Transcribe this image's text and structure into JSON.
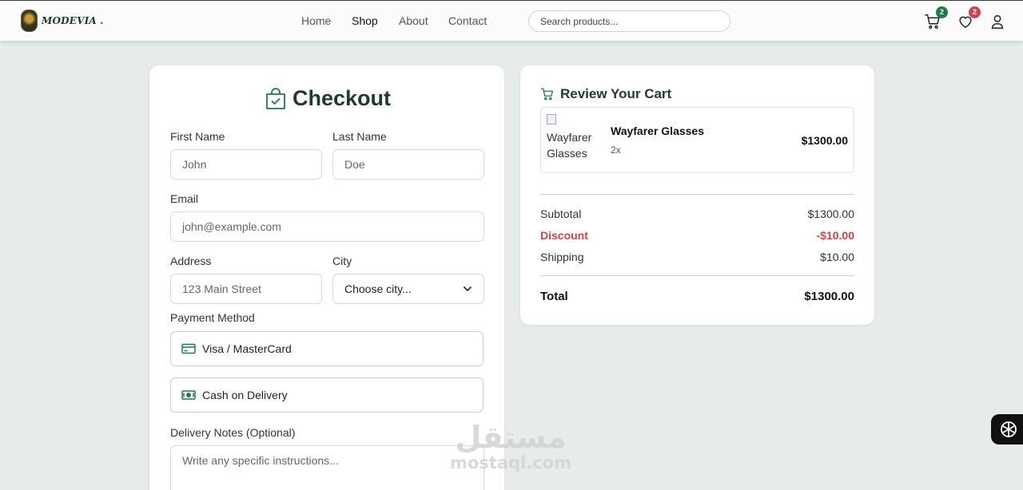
{
  "brand": {
    "name": "MODEVIA ."
  },
  "nav": {
    "links": [
      "Home",
      "Shop",
      "About",
      "Contact"
    ]
  },
  "search": {
    "placeholder": "Search products..."
  },
  "header_icons": {
    "cart_count": "2",
    "wishlist_count": "2"
  },
  "checkout": {
    "title": "Checkout",
    "first_name_label": "First Name",
    "first_name_placeholder": "John",
    "last_name_label": "Last Name",
    "last_name_placeholder": "Doe",
    "email_label": "Email",
    "email_placeholder": "john@example.com",
    "address_label": "Address",
    "address_placeholder": "123 Main Street",
    "city_label": "City",
    "city_selected": "Choose city...",
    "payment_label": "Payment Method",
    "payment_options": [
      "Visa / MasterCard",
      "Cash on Delivery"
    ],
    "notes_label": "Delivery Notes (Optional)",
    "notes_placeholder": "Write any specific instructions..."
  },
  "review": {
    "title": "Review Your Cart",
    "items": [
      {
        "img_alt": "Wayfarer Glasses",
        "name": "Wayfarer Glasses",
        "qty": "2x",
        "price": "$1300.00"
      }
    ],
    "subtotal_label": "Subtotal",
    "subtotal": "$1300.00",
    "discount_label": "Discount",
    "discount": "-$10.00",
    "shipping_label": "Shipping",
    "shipping": "$10.00",
    "total_label": "Total",
    "total": "$1300.00"
  },
  "watermark": {
    "arabic": "مستقل",
    "latin": "mostaql.com"
  },
  "colors": {
    "brand_green": "#1e7a4a",
    "discount_red": "#d0434e",
    "heading": "#1f3a2e"
  }
}
